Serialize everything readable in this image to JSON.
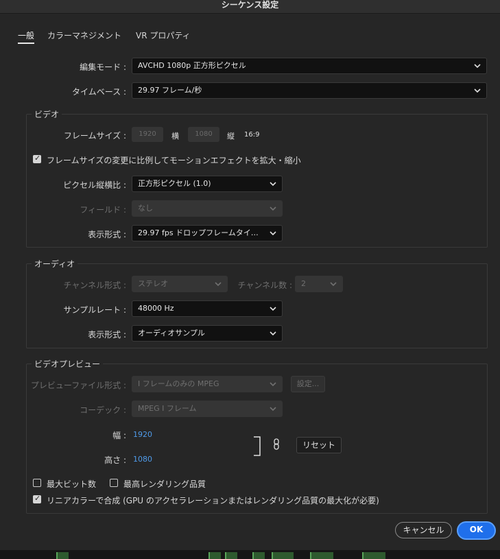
{
  "window": {
    "title": "シーケンス設定"
  },
  "tabs": [
    {
      "label": "一般",
      "active": true
    },
    {
      "label": "カラーマネジメント",
      "active": false
    },
    {
      "label": "VR プロパティ",
      "active": false
    }
  ],
  "general": {
    "edit_mode_label": "編集モード :",
    "edit_mode_value": "AVCHD 1080p 正方形ピクセル",
    "timebase_label": "タイムベース :",
    "timebase_value": "29.97  フレーム/秒"
  },
  "video": {
    "title": "ビデオ",
    "frame_size_label": "フレームサイズ :",
    "width": "1920",
    "width_label": "横",
    "height": "1080",
    "height_label": "縦",
    "aspect": "16:9",
    "scale_checkbox_label": "フレームサイズの変更に比例してモーションエフェクトを拡大・縮小",
    "pixel_aspect_label": "ピクセル縦横比 :",
    "pixel_aspect_value": "正方形ピクセル (1.0)",
    "fields_label": "フィールド :",
    "fields_value": "なし",
    "display_format_label": "表示形式 :",
    "display_format_value": "29.97 fps ドロップフレームタイ…"
  },
  "audio": {
    "title": "オーディオ",
    "channel_format_label": "チャンネル形式 :",
    "channel_format_value": "ステレオ",
    "channel_count_label": "チャンネル数 :",
    "channel_count_value": "2",
    "sample_rate_label": "サンプルレート :",
    "sample_rate_value": "48000 Hz",
    "display_format_label": "表示形式 :",
    "display_format_value": "オーディオサンプル"
  },
  "preview": {
    "title": "ビデオプレビュー",
    "file_format_label": "プレビューファイル形式 :",
    "file_format_value": "I フレームのみの MPEG",
    "settings_button": "設定...",
    "codec_label": "コーデック :",
    "codec_value": "MPEG I フレーム",
    "width_label": "幅 :",
    "width_value": "1920",
    "height_label": "高さ :",
    "height_value": "1080",
    "reset_button": "リセット",
    "max_bit_depth_label": "最大ビット数",
    "max_render_quality_label": "最高レンダリング品質",
    "linear_color_label": "リニアカラーで合成 (GPU のアクセラレーションまたはレンダリング品質の最大化が必要)"
  },
  "footer": {
    "cancel": "キャンセル",
    "ok": "OK"
  },
  "colors": {
    "accent": "#1f6feb",
    "link": "#4f9bea"
  }
}
